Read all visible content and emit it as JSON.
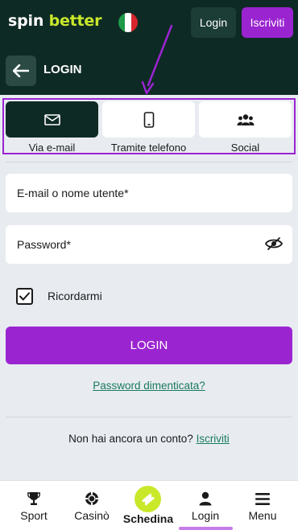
{
  "header": {
    "logo_part1": "spin",
    "logo_part2": "better",
    "login_label": "Login",
    "register_label": "Iscriviti"
  },
  "subheader": {
    "title": "LOGIN"
  },
  "tabs": [
    {
      "label": "Via e-mail",
      "icon": "envelope-icon",
      "active": true
    },
    {
      "label": "Tramite telefono",
      "icon": "phone-icon",
      "active": false
    },
    {
      "label": "Social",
      "icon": "users-icon",
      "active": false
    }
  ],
  "form": {
    "email_placeholder": "E-mail o nome utente*",
    "password_placeholder": "Password*",
    "remember_label": "Ricordarmi",
    "remember_checked": true,
    "submit_label": "LOGIN",
    "forgot_label": "Password dimenticata?",
    "no_account_text": "Non hai ancora un conto?",
    "register_link": "Iscriviti"
  },
  "bottom_nav": {
    "sport": "Sport",
    "casino": "Casinò",
    "schedina": "Schedina",
    "login": "Login",
    "menu": "Menu"
  },
  "colors": {
    "dark_green": "#0e2a25",
    "purple": "#9b24d1",
    "lime": "#c9e82a",
    "link_green": "#1a7a5e"
  }
}
